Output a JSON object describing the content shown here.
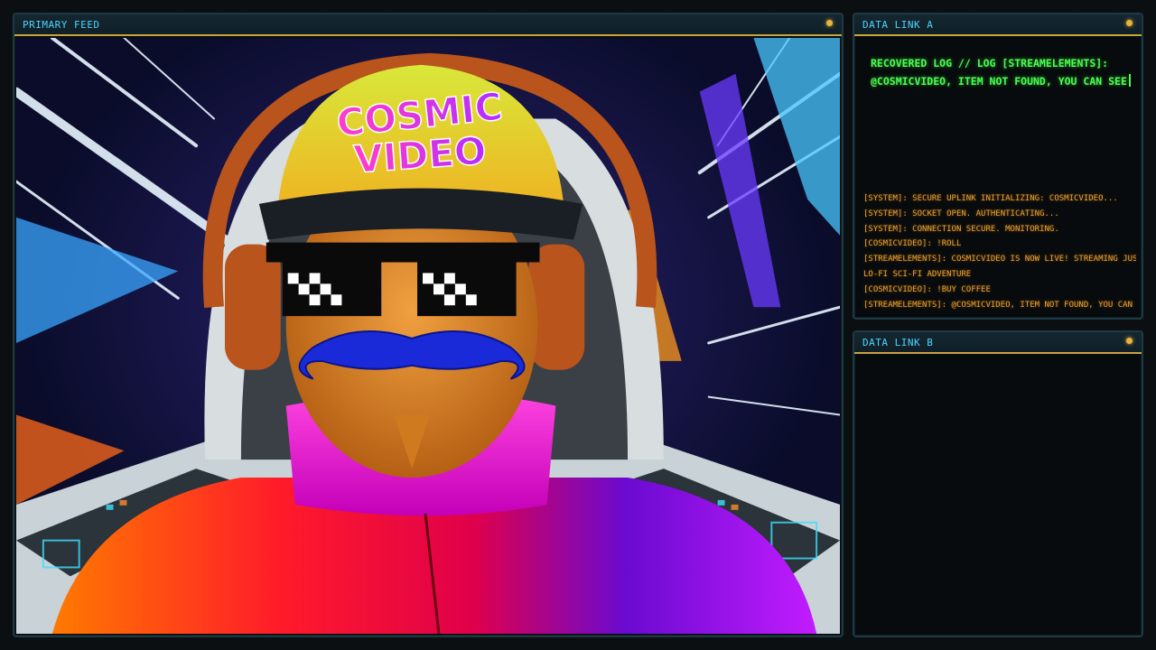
{
  "primary_feed": {
    "title": "PRIMARY FEED",
    "cap_text_line1": "COSMIC",
    "cap_text_line2": "VIDEO"
  },
  "data_link_a": {
    "title": "DATA LINK A",
    "recovered_line1": "RECOVERED LOG // LOG [STREAMELEMENTS]:",
    "recovered_line2": "@COSMICVIDEO, ITEM NOT FOUND, YOU CAN SEE",
    "log": [
      "[SYSTEM]: SECURE UPLINK INITIALIZING: COSMICVIDEO...",
      "[SYSTEM]: SOCKET OPEN. AUTHENTICATING...",
      "[SYSTEM]: CONNECTION SECURE. MONITORING.",
      "[COSMICVIDEO]: !ROLL",
      "[STREAMELEMENTS]: COSMICVIDEO IS NOW LIVE! STREAMING JUST",
      "LO-FI SCI-FI ADVENTURE",
      "[COSMICVIDEO]: !BUY COFFEE",
      "[STREAMELEMENTS]: @COSMICVIDEO, ITEM NOT FOUND, YOU CAN SI"
    ]
  },
  "data_link_b": {
    "title": "DATA LINK B"
  },
  "colors": {
    "accent_cyan": "#4fd4ff",
    "terminal_green": "#49ff4f",
    "log_orange": "#f0a02a",
    "status_amber": "#e8b53a"
  }
}
